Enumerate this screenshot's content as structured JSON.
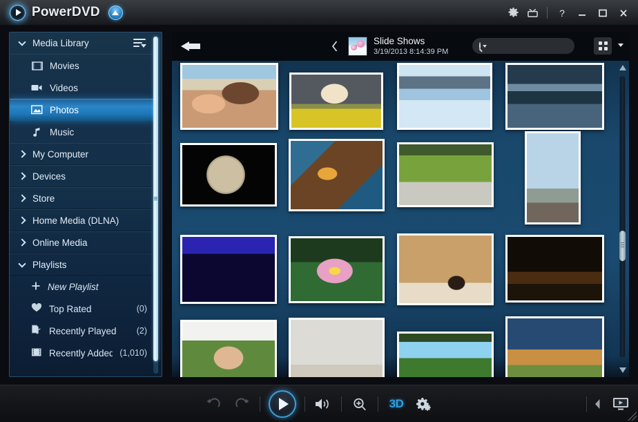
{
  "titlebar": {
    "app_name": "PowerDVD",
    "logo_icon": "play-orb-logo",
    "upgrade_icon": "upgrade-arrow-badge",
    "buttons": [
      {
        "name": "settings-button",
        "icon": "gear-icon"
      },
      {
        "name": "tv-mode-button",
        "icon": "tv-icon"
      },
      {
        "name": "help-button",
        "icon": "question-mark-icon"
      },
      {
        "name": "minimize-button",
        "icon": "minimize-icon"
      },
      {
        "name": "maximize-button",
        "icon": "maximize-icon"
      },
      {
        "name": "close-button",
        "icon": "close-icon"
      }
    ]
  },
  "sidebar": {
    "media_library": {
      "label": "Media Library",
      "sort_icon": "sort-list-icon",
      "expanded": true,
      "items": [
        {
          "label": "Movies",
          "icon": "film-strip-icon",
          "active": false
        },
        {
          "label": "Videos",
          "icon": "video-camera-icon",
          "active": false
        },
        {
          "label": "Photos",
          "icon": "photo-icon",
          "active": true
        },
        {
          "label": "Music",
          "icon": "music-note-icon",
          "active": false
        }
      ]
    },
    "sections": [
      {
        "label": "My Computer",
        "expanded": false
      },
      {
        "label": "Devices",
        "expanded": false
      },
      {
        "label": "Store",
        "expanded": false
      },
      {
        "label": "Home Media (DLNA)",
        "expanded": false
      },
      {
        "label": "Online Media",
        "expanded": false
      }
    ],
    "playlists": {
      "label": "Playlists",
      "expanded": true,
      "items": [
        {
          "label": "New Playlist",
          "icon": "plus-icon",
          "count": "",
          "italic": true
        },
        {
          "label": "Top Rated",
          "icon": "heart-icon",
          "count": "(0)",
          "italic": false
        },
        {
          "label": "Recently Played",
          "icon": "document-note-icon",
          "count": "(2)",
          "italic": false
        },
        {
          "label": "Recently Added",
          "icon": "film-strip-icon",
          "count": "(1,010)",
          "italic": false
        }
      ]
    }
  },
  "content_header": {
    "back_icon": "back-arrow-icon",
    "prev_icon": "chevron-left-icon",
    "next_icon": "chevron-right-icon",
    "folder_thumb_icon": "flower-butterfly-thumbnail",
    "title": "Slide Shows",
    "date": "3/19/2013 8:14:39 PM",
    "search": {
      "icon": "search-icon",
      "dropdown_icon": "chevron-down-icon",
      "value": "",
      "placeholder": ""
    },
    "view_toggle": {
      "icon": "grid-view-icon",
      "dropdown_icon": "chevron-down-icon"
    }
  },
  "photo_grid": {
    "photos": [
      {
        "name": "couple-on-beach",
        "row": 1,
        "col": 1
      },
      {
        "name": "dog-in-yellow-flowers",
        "row": 1,
        "col": 2
      },
      {
        "name": "calm-lake-reflection",
        "row": 1,
        "col": 3
      },
      {
        "name": "snowy-mountain-lake",
        "row": 1,
        "col": 4
      },
      {
        "name": "moon-at-night",
        "row": 2,
        "col": 1
      },
      {
        "name": "amber-wood-macro",
        "row": 2,
        "col": 2
      },
      {
        "name": "bicycle-in-meadow",
        "row": 2,
        "col": 3
      },
      {
        "name": "statue-of-liberty",
        "row": 2,
        "col": 4
      },
      {
        "name": "lightning-storm",
        "row": 3,
        "col": 1
      },
      {
        "name": "pink-lotus-flower",
        "row": 3,
        "col": 2
      },
      {
        "name": "lioness-portrait",
        "row": 3,
        "col": 3
      },
      {
        "name": "bridge-at-night",
        "row": 3,
        "col": 4
      },
      {
        "name": "woman-portrait",
        "row": 4,
        "col": 1
      },
      {
        "name": "foggy-trees",
        "row": 4,
        "col": 2
      },
      {
        "name": "forest-and-sky",
        "row": 4,
        "col": 3
      },
      {
        "name": "sunset-over-field",
        "row": 4,
        "col": 4
      }
    ],
    "scrollbar": {
      "up_icon": "scroll-up-arrow",
      "down_icon": "scroll-down-arrow"
    }
  },
  "bottombar": {
    "controls": [
      {
        "name": "rotate-left-button",
        "icon": "rotate-counterclockwise-icon"
      },
      {
        "name": "rotate-right-button",
        "icon": "rotate-clockwise-icon"
      },
      {
        "name": "play-button",
        "icon": "play-icon"
      },
      {
        "name": "volume-button",
        "icon": "speaker-icon"
      },
      {
        "name": "zoom-button",
        "icon": "magnifier-plus-icon"
      },
      {
        "name": "3d-button",
        "icon": "3d-icon",
        "label": "3D"
      },
      {
        "name": "settings-button",
        "icon": "gears-icon"
      }
    ],
    "right": [
      {
        "name": "collapse-panel-button",
        "icon": "chevron-left-icon"
      },
      {
        "name": "display-output-button",
        "icon": "tv-play-icon"
      }
    ]
  },
  "colors": {
    "accent_blue": "#2f9fe0",
    "sidebar_top": "#17344a",
    "sidebar_bottom": "#0c1d33",
    "content_blue": "#1a4a70",
    "titlebar": "#2c2f34"
  }
}
